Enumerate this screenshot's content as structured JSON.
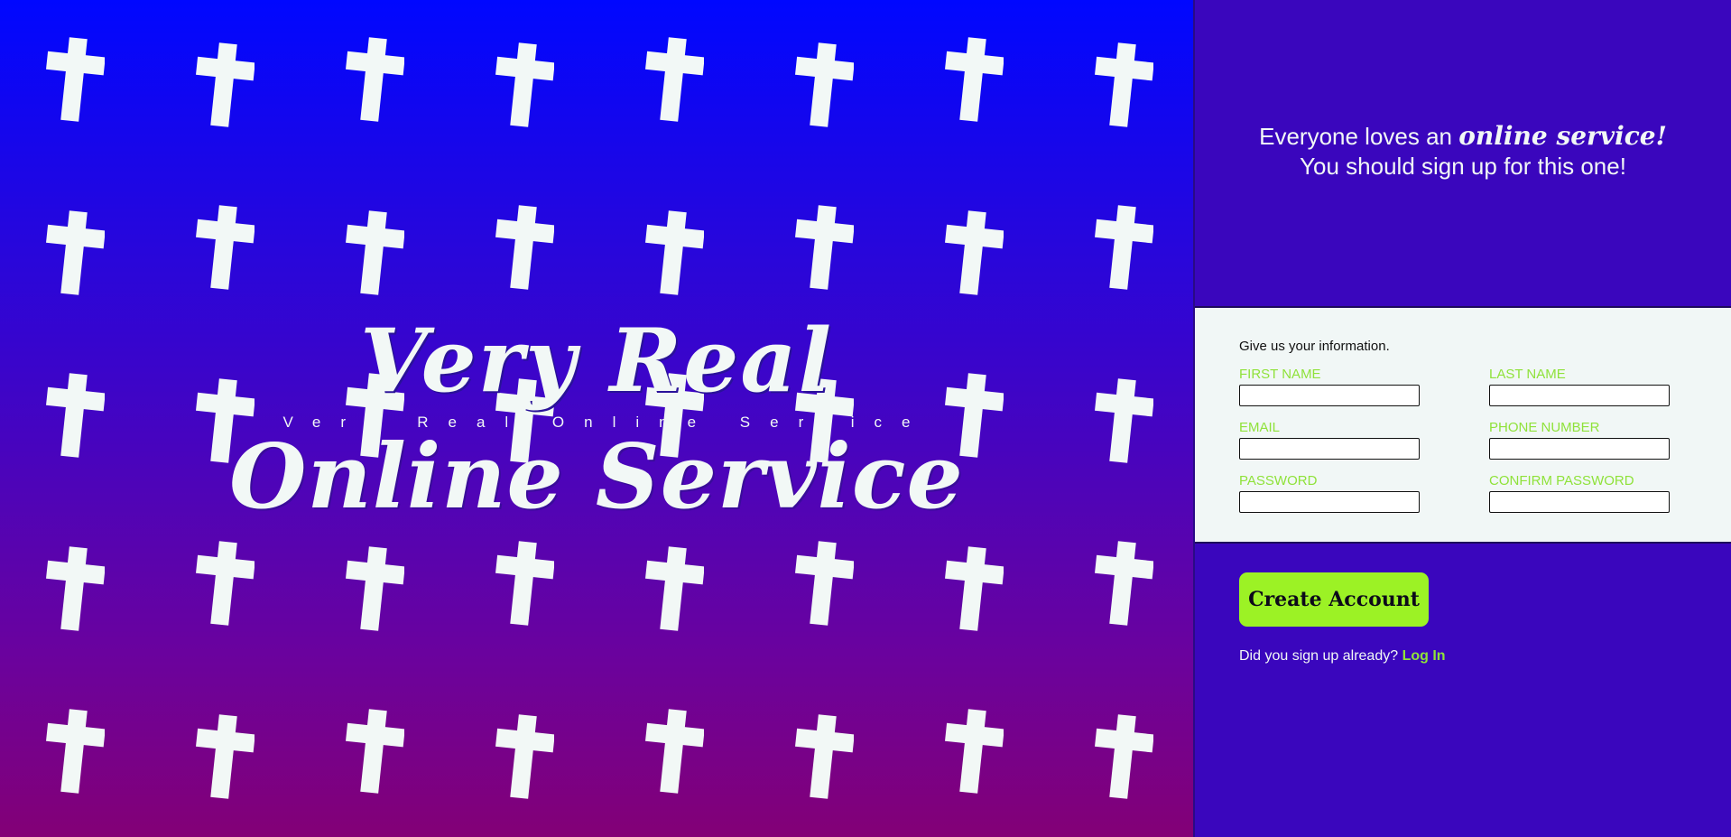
{
  "colors": {
    "hero_gradient_top": "#0007ff",
    "hero_gradient_bottom": "#830076",
    "sidebar_bg": "#3a06bd",
    "form_bg": "#f1f7f6",
    "accent_green": "#9cf225",
    "label_green": "#8fe23a",
    "cross_color": "#f2f8f6"
  },
  "hero": {
    "pattern_icon": "cross-icon",
    "title_line1": "Very Real",
    "subtitle": "Very Real Online Service",
    "title_line2": "Online Service"
  },
  "promo": {
    "line1_prefix": "Everyone loves an ",
    "line1_accent": "online service!",
    "line2": "You should sign up for this one!"
  },
  "form": {
    "intro": "Give us your information.",
    "fields": {
      "first_name": {
        "label": "First Name",
        "value": ""
      },
      "last_name": {
        "label": "Last Name",
        "value": ""
      },
      "email": {
        "label": "Email",
        "value": ""
      },
      "phone": {
        "label": "Phone Number",
        "value": ""
      },
      "password": {
        "label": "Password",
        "value": ""
      },
      "confirm_password": {
        "label": "Confirm Password",
        "value": ""
      }
    }
  },
  "actions": {
    "create_label": "Create Account",
    "signin_prompt": "Did you sign up already? ",
    "login_label": "Log In"
  }
}
